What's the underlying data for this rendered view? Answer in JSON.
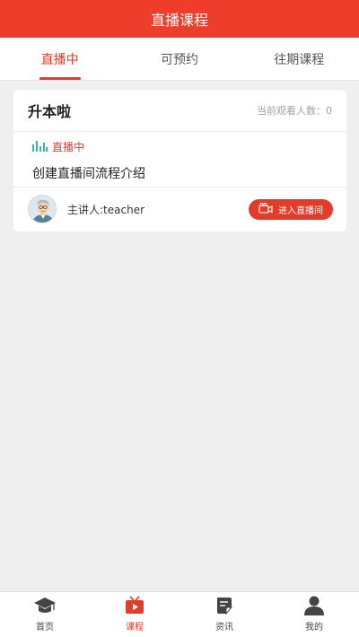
{
  "header": {
    "title": "直播课程"
  },
  "tabs": [
    {
      "label": "直播中",
      "active": true
    },
    {
      "label": "可预约",
      "active": false
    },
    {
      "label": "往期课程",
      "active": false
    }
  ],
  "card": {
    "title": "升本啦",
    "viewers_label": "当前观看人数：0",
    "status": "直播中",
    "course_title": "创建直播间流程介绍",
    "teacher": "主讲人:teacher",
    "enter_button": "进入直播间"
  },
  "tabbar": [
    {
      "label": "首页",
      "icon": "graduation-cap-icon",
      "active": false
    },
    {
      "label": "课程",
      "icon": "tv-play-icon",
      "active": true
    },
    {
      "label": "资讯",
      "icon": "news-icon",
      "active": false
    },
    {
      "label": "我的",
      "icon": "person-icon",
      "active": false
    }
  ],
  "colors": {
    "accent": "#e23d2b",
    "header": "#ee3e2b",
    "live_bars": "#3ab5a4"
  }
}
